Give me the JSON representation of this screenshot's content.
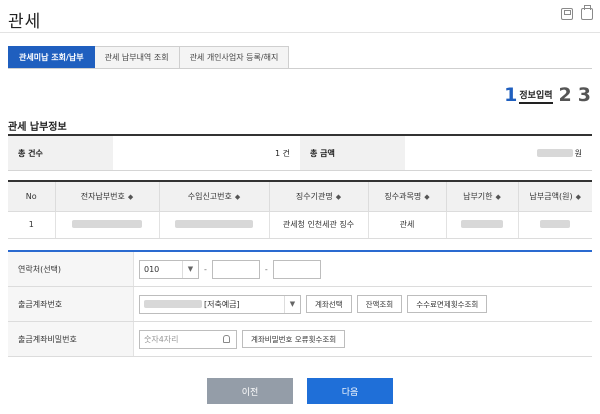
{
  "page": {
    "title": "관세"
  },
  "tabs": [
    {
      "label": "관세미납 조회/납부",
      "active": true
    },
    {
      "label": "관세 납부내역 조회",
      "active": false
    },
    {
      "label": "관세 개인사업자 등록/해지",
      "active": false
    }
  ],
  "steps": {
    "step1": "1",
    "step1_label": "정보입력",
    "step2": "2",
    "step3": "3"
  },
  "section": {
    "title": "관세 납부정보"
  },
  "summary": {
    "count_label": "총 건수",
    "count_value": "1 건",
    "amount_label": "총 금액",
    "amount_unit": "원"
  },
  "table": {
    "headers": [
      "No",
      "전자납부번호",
      "수입신고번호",
      "징수기관명",
      "징수과목명",
      "납부기한",
      "납부금액(원)"
    ],
    "rows": [
      {
        "no": "1",
        "agency": "관세청 인천세관 징수",
        "subject": "관세"
      }
    ]
  },
  "form": {
    "contact_label": "연락처(선택)",
    "phone_prefix": "010",
    "dash": "-",
    "account_label": "출금계좌번호",
    "account_type": "[저축예금]",
    "btn_select_account": "계좌선택",
    "btn_balance": "잔액조회",
    "btn_fee_exempt": "수수료면제횟수조회",
    "password_label": "출금계좌비밀번호",
    "password_placeholder": "숫자4자리",
    "btn_pw_errors": "계좌비밀번호 오류횟수조회"
  },
  "actions": {
    "prev": "이전",
    "next": "다음"
  },
  "colors": {
    "accent": "#1f5fbf",
    "button_primary": "#1f6fd8",
    "button_secondary": "#949da8"
  }
}
